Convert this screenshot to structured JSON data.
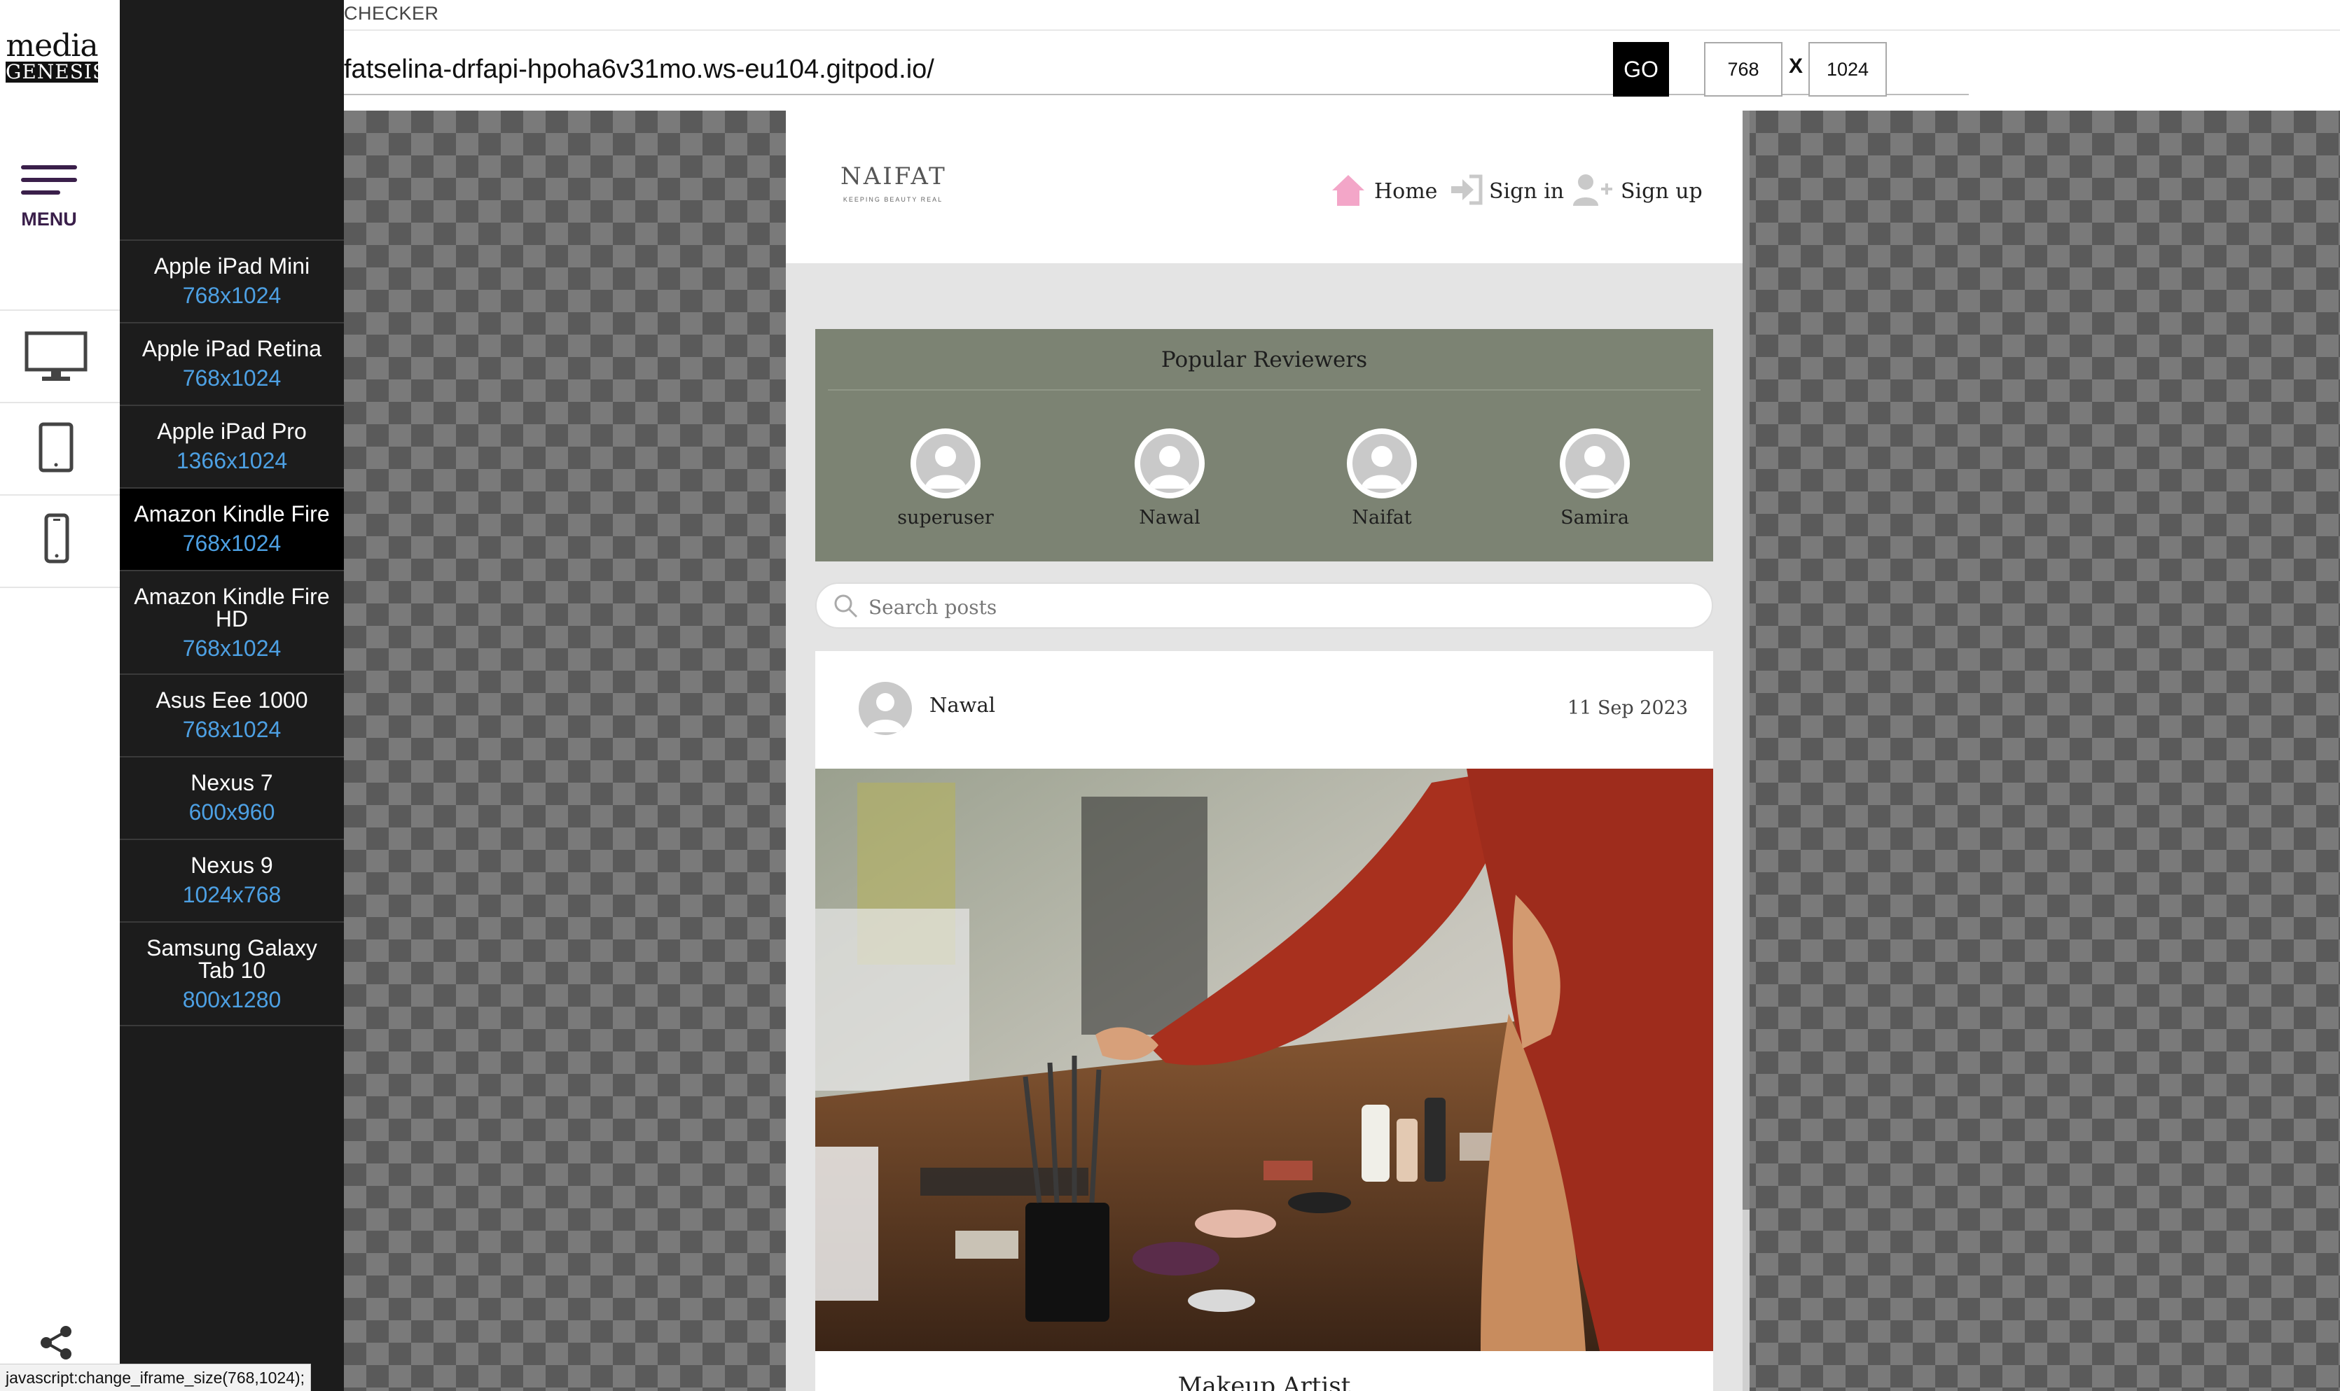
{
  "brand": {
    "line1": "media",
    "line2": "GENESIS"
  },
  "menu": {
    "label": "MENU"
  },
  "rail_icons": [
    "desktop-icon",
    "tablet-icon",
    "phone-icon",
    "share-icon"
  ],
  "devices": [
    {
      "name": "Apple iPad Mini",
      "size": "768x1024",
      "active": false
    },
    {
      "name": "Apple iPad Retina",
      "size": "768x1024",
      "active": false
    },
    {
      "name": "Apple iPad Pro",
      "size": "1366x1024",
      "active": false
    },
    {
      "name": "Amazon Kindle Fire",
      "size": "768x1024",
      "active": true
    },
    {
      "name": "Amazon Kindle Fire HD",
      "size": "768x1024",
      "active": false
    },
    {
      "name": "Asus Eee 1000",
      "size": "768x1024",
      "active": false
    },
    {
      "name": "Nexus 7",
      "size": "600x960",
      "active": false
    },
    {
      "name": "Nexus 9",
      "size": "1024x768",
      "active": false
    },
    {
      "name": "Samsung Galaxy Tab 10",
      "size": "800x1280",
      "active": false
    }
  ],
  "toolbar": {
    "title": "CHECKER",
    "url": "fatselina-drfapi-hpoha6v31mo.ws-eu104.gitpod.io/",
    "go_label": "GO",
    "width": "768",
    "x_label": "X",
    "height": "1024"
  },
  "site": {
    "logo": "NAIFAT",
    "tagline": "KEEPING BEAUTY REAL",
    "nav": {
      "home": "Home",
      "signin": "Sign in",
      "signup": "Sign up"
    },
    "reviewers_title": "Popular Reviewers",
    "reviewers": [
      "superuser",
      "Nawal",
      "Naifat",
      "Samira"
    ],
    "search_placeholder": "Search posts",
    "post": {
      "author": "Nawal",
      "date": "11 Sep 2023",
      "title": "Makeup Artist"
    }
  },
  "colors": {
    "panel_bg": "#1c1c1c",
    "device_size": "#4da0e3",
    "reviewers_bg": "#7c8373",
    "home_icon": "#f3a6c8",
    "menu_accent": "#3a1f4a"
  },
  "status": "javascript:change_iframe_size(768,1024);"
}
